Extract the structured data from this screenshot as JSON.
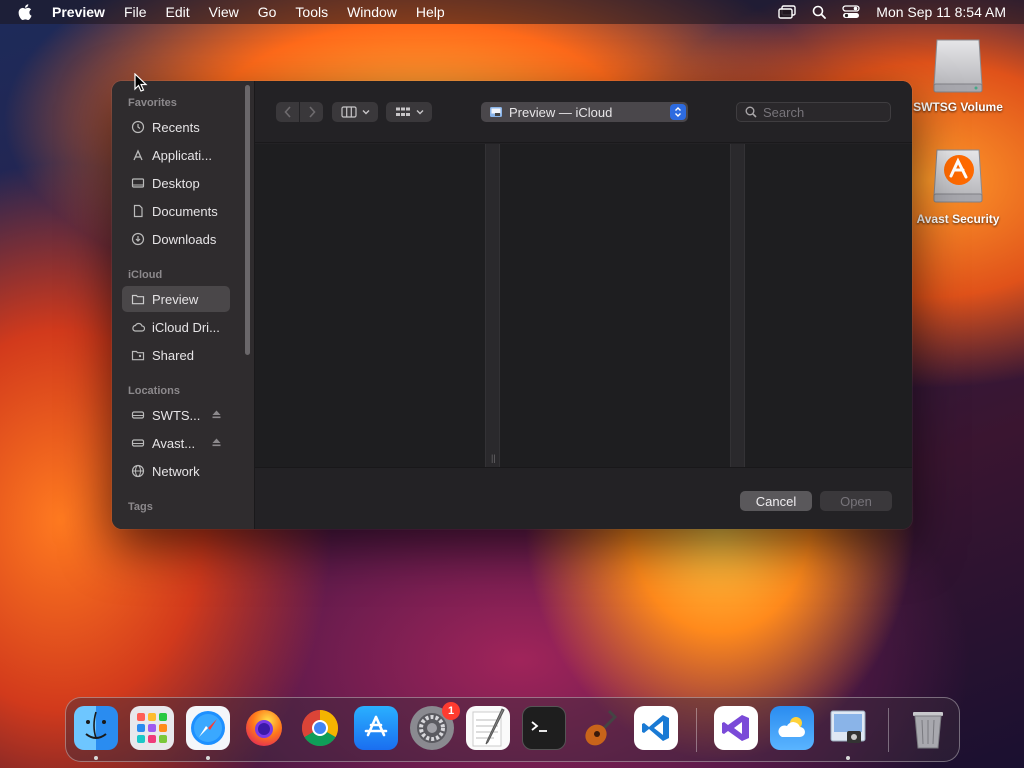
{
  "menubar": {
    "app_name": "Preview",
    "menus": [
      "File",
      "Edit",
      "View",
      "Go",
      "Tools",
      "Window",
      "Help"
    ],
    "clock": "Mon Sep 11  8:54 AM",
    "status_icons": [
      "screen-mirroring-icon",
      "spotlight-icon",
      "control-center-icon"
    ]
  },
  "desktop_icons": [
    {
      "label": "SWTSG Volume",
      "icon": "external-drive-icon"
    },
    {
      "label": "Avast Security",
      "icon": "avast-drive-icon"
    }
  ],
  "dialog": {
    "sidebar": {
      "sections": [
        {
          "title": "Favorites",
          "items": [
            {
              "label": "Recents",
              "icon": "clock-icon"
            },
            {
              "label": "Applicati...",
              "icon": "applications-icon"
            },
            {
              "label": "Desktop",
              "icon": "desktop-icon"
            },
            {
              "label": "Documents",
              "icon": "document-icon"
            },
            {
              "label": "Downloads",
              "icon": "download-icon"
            }
          ]
        },
        {
          "title": "iCloud",
          "items": [
            {
              "label": "Preview",
              "icon": "folder-icon",
              "selected": true
            },
            {
              "label": "iCloud Dri...",
              "icon": "cloud-icon"
            },
            {
              "label": "Shared",
              "icon": "shared-folder-icon"
            }
          ]
        },
        {
          "title": "Locations",
          "items": [
            {
              "label": "SWTS...",
              "icon": "drive-icon",
              "eject": true
            },
            {
              "label": "Avast...",
              "icon": "drive-icon",
              "eject": true
            },
            {
              "label": "Network",
              "icon": "globe-icon"
            }
          ]
        },
        {
          "title": "Tags",
          "items": []
        }
      ]
    },
    "toolbar": {
      "location": "Preview — iCloud",
      "search_placeholder": "Search"
    },
    "footer": {
      "cancel_label": "Cancel",
      "open_label": "Open"
    }
  },
  "dock": {
    "apps": [
      {
        "name": "Finder",
        "running": true
      },
      {
        "name": "Launchpad",
        "running": false
      },
      {
        "name": "Safari",
        "running": true
      },
      {
        "name": "Firefox",
        "running": false
      },
      {
        "name": "Chrome",
        "running": false
      },
      {
        "name": "App Store",
        "running": false
      },
      {
        "name": "System Settings",
        "running": false,
        "badge": "1"
      },
      {
        "name": "TextEdit",
        "running": false
      },
      {
        "name": "Terminal",
        "running": false
      },
      {
        "name": "GarageBand",
        "running": false
      },
      {
        "name": "Visual Studio Code",
        "running": false
      },
      {
        "name": "Visual Studio",
        "running": false
      },
      {
        "name": "Weather",
        "running": false
      },
      {
        "name": "Preview",
        "running": true
      },
      {
        "name": "Trash",
        "running": false
      }
    ]
  }
}
